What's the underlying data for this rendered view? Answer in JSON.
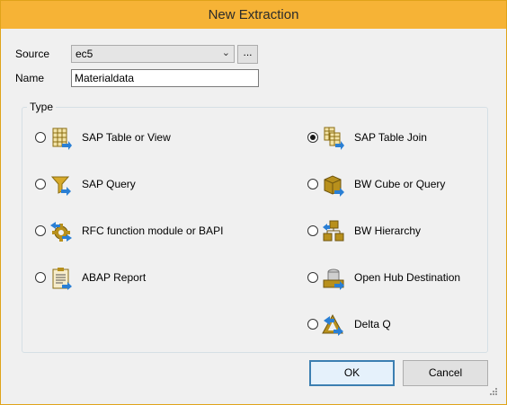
{
  "window": {
    "title": "New Extraction"
  },
  "form": {
    "source_label": "Source",
    "source_value": "ec5",
    "browse_label": "...",
    "name_label": "Name",
    "name_value": "Materialdata"
  },
  "type_group": {
    "legend": "Type",
    "options": [
      {
        "label": "SAP Table or View",
        "icon": "table-icon",
        "checked": false
      },
      {
        "label": "SAP Query",
        "icon": "funnel-icon",
        "checked": false
      },
      {
        "label": "RFC function module or BAPI",
        "icon": "gear-icon",
        "checked": false
      },
      {
        "label": "ABAP Report",
        "icon": "clipboard-report-icon",
        "checked": false
      },
      {
        "label": "SAP Table Join",
        "icon": "joined-tables-icon",
        "checked": true
      },
      {
        "label": "BW Cube or Query",
        "icon": "cube-icon",
        "checked": false
      },
      {
        "label": "BW Hierarchy",
        "icon": "hierarchy-icon",
        "checked": false
      },
      {
        "label": "Open Hub Destination",
        "icon": "open-hub-icon",
        "checked": false
      },
      {
        "label": "Delta Q",
        "icon": "delta-icon",
        "checked": false
      }
    ]
  },
  "buttons": {
    "ok": "OK",
    "cancel": "Cancel"
  },
  "colors": {
    "titlebar": "#f6b336",
    "accent_blue": "#2a7fd4",
    "icon_gold": "#c9a227"
  }
}
